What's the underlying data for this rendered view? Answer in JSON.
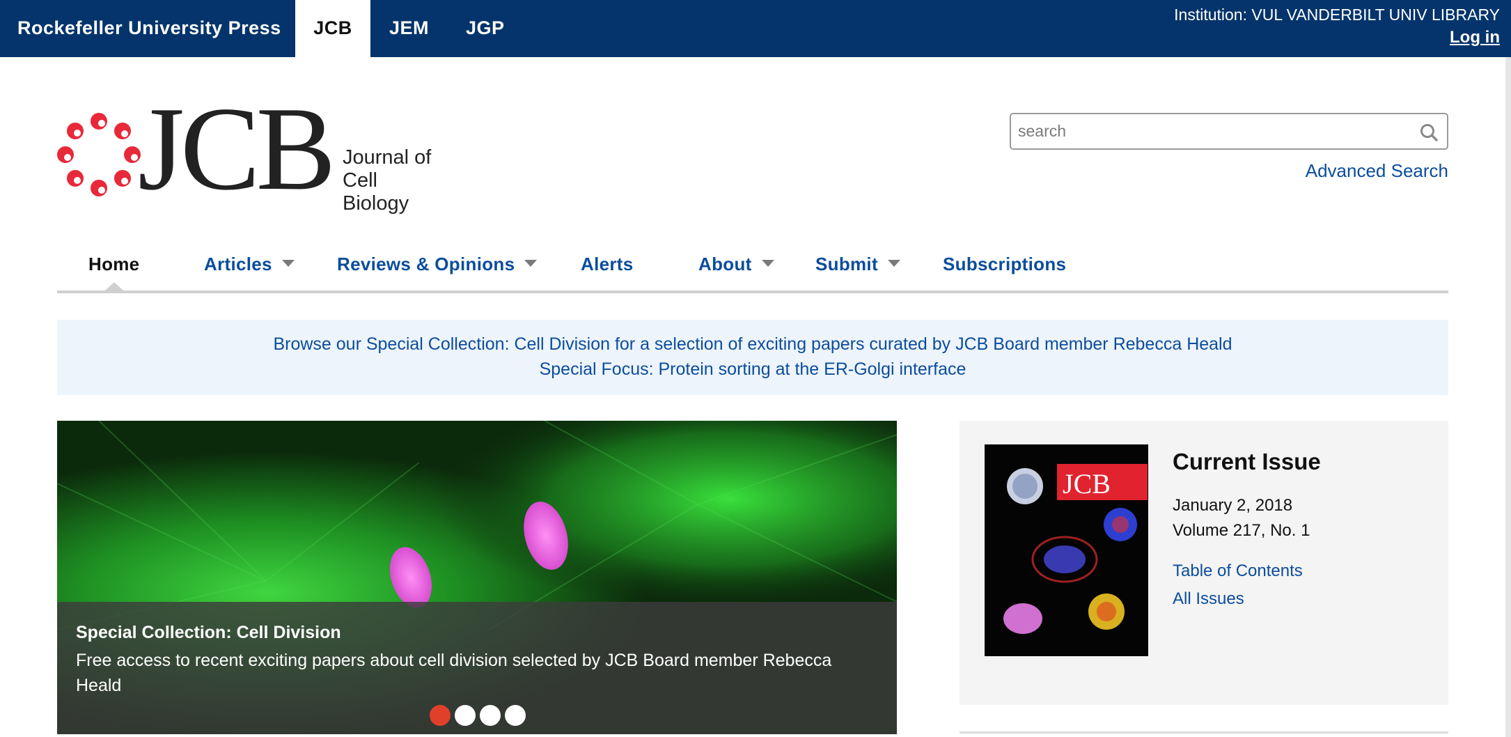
{
  "topbar": {
    "press": "Rockefeller University Press",
    "tabs": [
      "JCB",
      "JEM",
      "JGP"
    ],
    "institution": "Institution: VUL VANDERBILT UNIV LIBRARY",
    "login": "Log in"
  },
  "logo": {
    "wordmark": "JCB",
    "subtitle_line1": "Journal of",
    "subtitle_line2": "Cell Biology"
  },
  "search": {
    "placeholder": "search",
    "advanced": "Advanced Search"
  },
  "nav": {
    "items": [
      "Home",
      "Articles",
      "Reviews & Opinions",
      "Alerts",
      "About",
      "Submit",
      "Subscriptions"
    ],
    "active": "Home"
  },
  "announcement": {
    "line1": "Browse our Special Collection: Cell Division for a selection of exciting papers curated by JCB Board member Rebecca Heald",
    "line2": "Special Focus: Protein sorting at the ER-Golgi interface"
  },
  "carousel": {
    "title": "Special Collection: Cell Division",
    "description": "Free access to recent exciting papers about cell division selected by JCB Board member Rebecca Heald",
    "slide_count": 4,
    "active_slide": 1
  },
  "current_issue": {
    "heading": "Current Issue",
    "date": "January 2, 2018",
    "volume": "Volume 217, No. 1",
    "toc": "Table of Contents",
    "all_issues": "All Issues",
    "cover_wordmark": "JCB"
  },
  "colors": {
    "topbar": "#04346b",
    "link": "#0b4d9c",
    "accent_red": "#e0402a",
    "logo_red": "#e8293a"
  }
}
